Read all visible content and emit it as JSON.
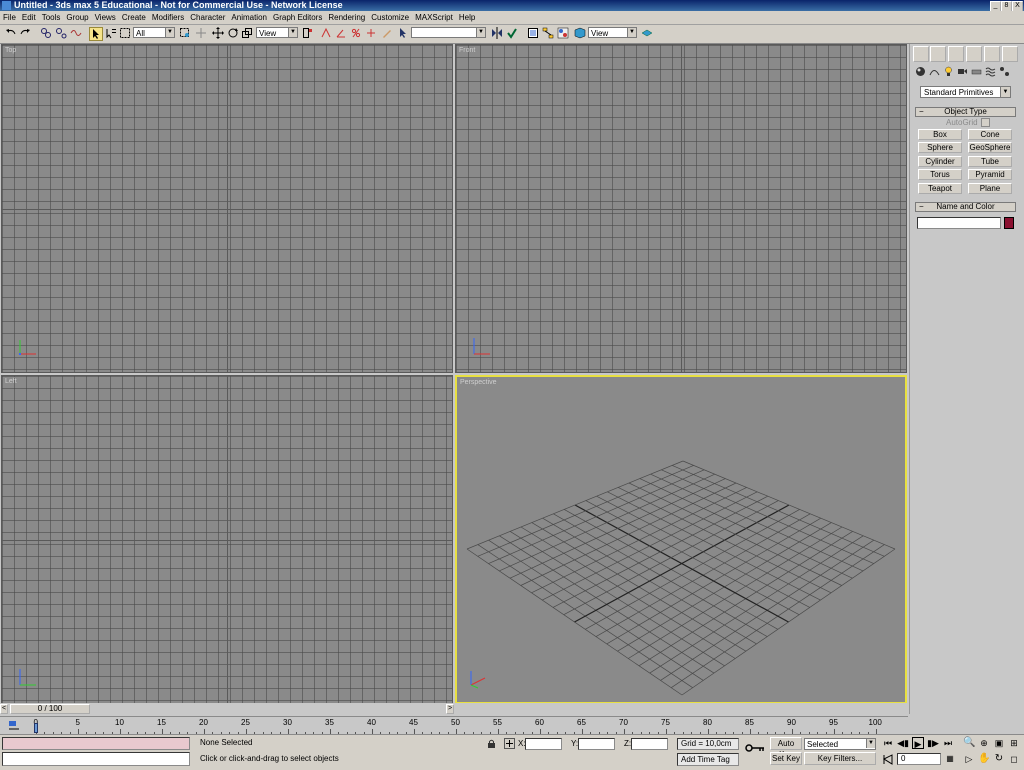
{
  "window": {
    "title": "Untitled - 3ds max 5 Educational - Not for Commercial Use - Network License",
    "controls": [
      "_",
      "8",
      "X"
    ]
  },
  "menu": [
    "File",
    "Edit",
    "Tools",
    "Group",
    "Views",
    "Create",
    "Modifiers",
    "Character",
    "Animation",
    "Graph Editors",
    "Rendering",
    "Customize",
    "MAXScript",
    "Help"
  ],
  "toolbar": {
    "selection_filter": "All",
    "ref_coord": "View",
    "named_selection": "",
    "render_type": "View"
  },
  "viewports": {
    "top": "Top",
    "front": "Front",
    "left": "Left",
    "perspective": "Perspective",
    "active_border": "#e8e040"
  },
  "command_panel": {
    "category": "Standard Primitives",
    "object_type_title": "Object Type",
    "autogrid": "AutoGrid",
    "buttons": [
      "Box",
      "Cone",
      "Sphere",
      "GeoSphere",
      "Cylinder",
      "Tube",
      "Torus",
      "Pyramid",
      "Teapot",
      "Plane"
    ],
    "name_color_title": "Name and Color",
    "object_color": "#8a1030"
  },
  "timeline": {
    "frame_display": "0 / 100",
    "ticks": [
      "0",
      "5",
      "10",
      "15",
      "20",
      "25",
      "30",
      "35",
      "40",
      "45",
      "50",
      "55",
      "60",
      "65",
      "70",
      "75",
      "80",
      "85",
      "90",
      "95",
      "100"
    ],
    "current_frame": 0,
    "total_frames": 100
  },
  "status": {
    "selection": "None Selected",
    "prompt": "Click or click-and-drag to select objects",
    "x_label": "X:",
    "y_label": "Y:",
    "z_label": "Z:",
    "grid": "Grid = 10,0cm",
    "add_time_tag": "Add Time Tag",
    "auto_key": "Auto Key",
    "set_key": "Set Key",
    "key_mode": "Selected",
    "key_filters": "Key Filters...",
    "frame": "0"
  }
}
